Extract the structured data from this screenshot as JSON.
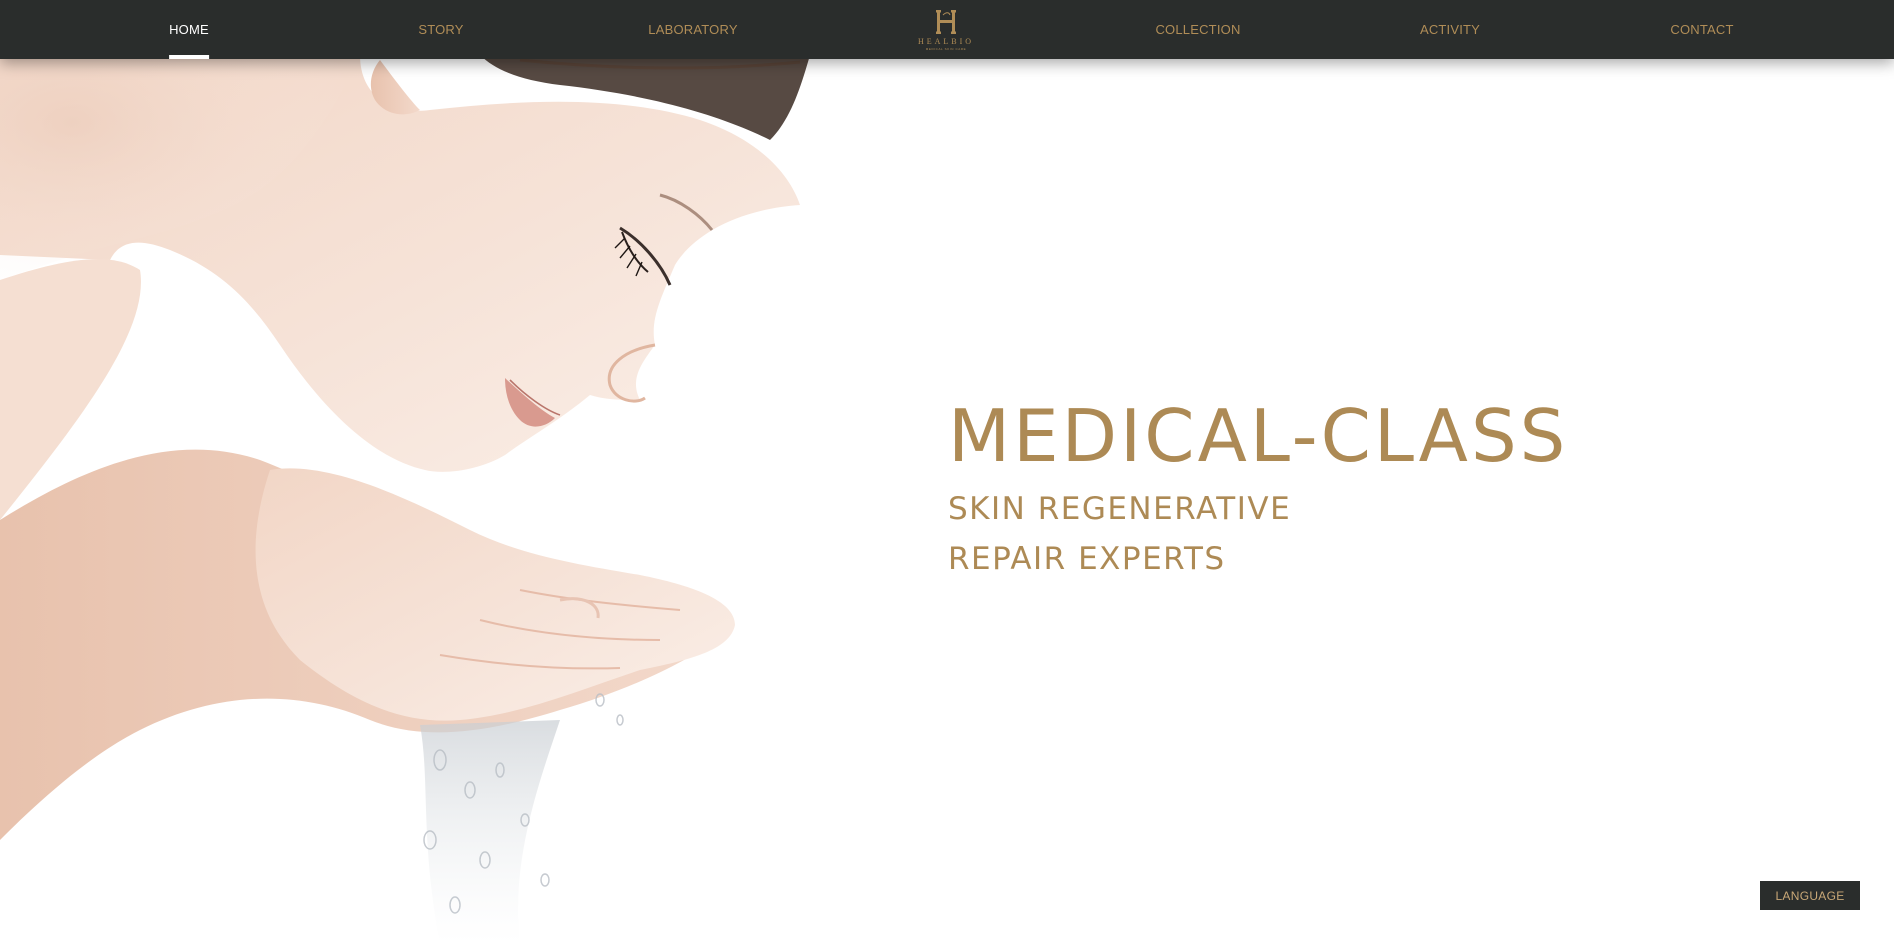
{
  "nav": {
    "items": [
      {
        "label": "HOME",
        "active": true
      },
      {
        "label": "STORY",
        "active": false
      },
      {
        "label": "LABORATORY",
        "active": false
      },
      {
        "label": "COLLECTION",
        "active": false
      },
      {
        "label": "ACTIVITY",
        "active": false
      },
      {
        "label": "CONTACT",
        "active": false
      }
    ],
    "logo": {
      "monogram": "H",
      "word": "HEALBIO",
      "tagline": "MEDICAL SKIN CARE"
    }
  },
  "hero": {
    "image": "woman-washing-face-photo",
    "headline": "MEDICAL-CLASS",
    "subline_1": "SKIN REGENERATIVE",
    "subline_2": "REPAIR EXPERTS"
  },
  "language_button": {
    "label": "LANGUAGE"
  },
  "colors": {
    "nav_bg": "#2a2d2c",
    "gold": "#b08d57",
    "active_text": "#ffffff",
    "page_bg": "#ffffff"
  }
}
